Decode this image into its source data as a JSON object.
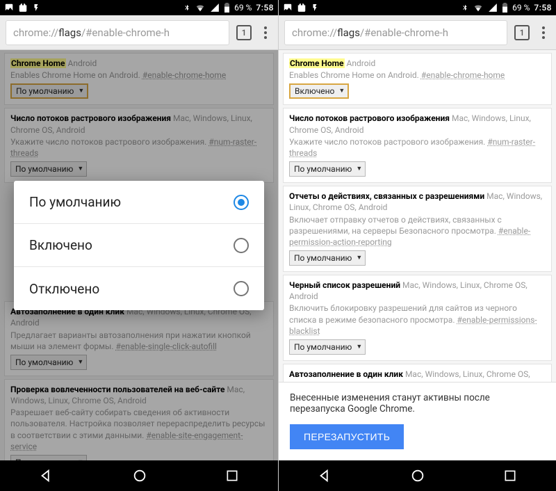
{
  "status": {
    "battery": "69 %",
    "time": "7:58"
  },
  "url": {
    "pre": "chrome://",
    "hl": "flags",
    "post": "/#enable-chrome-h"
  },
  "tabs": "1",
  "select_default": "По умолчанию",
  "select_enabled": "Включено",
  "dialog": {
    "opt_default": "По умолчанию",
    "opt_enabled": "Включено",
    "opt_disabled": "Отключено"
  },
  "banner": {
    "text": "Внесенные изменения станут активны после перезапуска Google Chrome.",
    "button": "ПЕРЕЗАПУСТИТЬ"
  },
  "flags": {
    "chrome_home": {
      "title": "Chrome Home",
      "plat": "Android",
      "desc": "Enables Chrome Home on Android.",
      "hash": "#enable-chrome-home"
    },
    "raster": {
      "title": "Число потоков растрового изображения",
      "plat": "Mac, Windows, Linux, Chrome OS, Android",
      "desc": "Укажите число потоков растрового изображения.",
      "hash": "#num-raster-threads"
    },
    "perm_report": {
      "title": "Отчеты о действиях, связанных с разрешениями",
      "plat": "Mac, Windows, Linux, Chrome OS, Android",
      "desc": "Включает отправку отчетов о действиях, связанных с разрешениями, на серверы Безопасного просмотра.",
      "hash": "#enable-permission-action-reporting"
    },
    "perm_black": {
      "title": "Черный список разрешений",
      "plat": "Mac, Windows, Linux, Chrome OS, Android",
      "desc": "Включить блокировку разрешений для сайтов из черного списка в режиме безопасного просмотра.",
      "hash": "#enable-permissions-blacklist"
    },
    "autofill": {
      "title": "Автозаполнение в один клик",
      "plat": "Mac, Windows, Linux, Chrome OS, Android",
      "desc": "Предлагает варианты автозаполнения при нажатии кнопкой мыши на элемент формы.",
      "hash": "#enable-single-click-autofill"
    },
    "engage": {
      "title": "Проверка вовлеченности пользователей на веб-сайте",
      "plat": "Mac, Windows, Linux, Chrome OS, Android",
      "desc": "Разрешает веб-сайту собирать сведения об активности пользователя. Настройка позволяет перераспределить ресурсы в соответствии с этими данными.",
      "hash": "#enable-site-engagement-service"
    }
  }
}
